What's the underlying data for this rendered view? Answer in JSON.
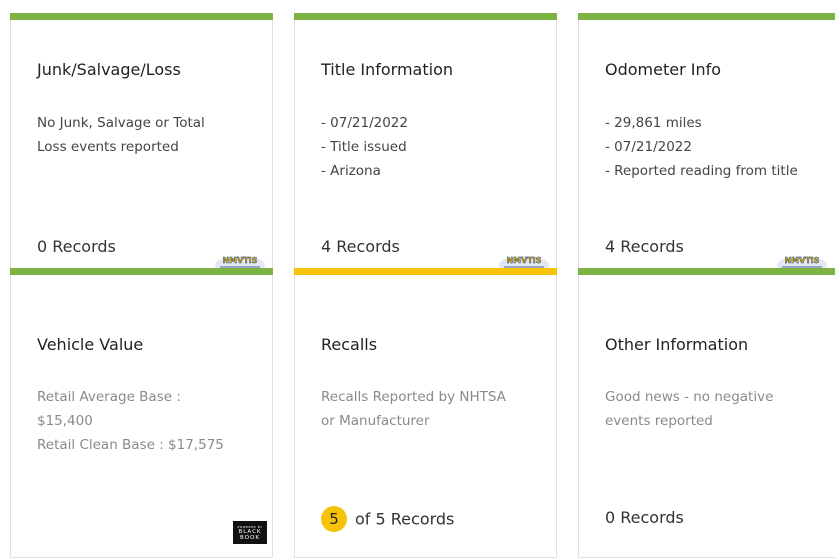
{
  "colors": {
    "green": "#7cb342",
    "yellow": "#f7c20a"
  },
  "cards": [
    {
      "title": "Junk/Salvage/Loss",
      "lines": [
        "No Junk, Salvage or Total",
        "Loss events reported"
      ],
      "records": "0 Records",
      "logo": "NMVTIS"
    },
    {
      "title": "Title Information",
      "lines": [
        "- 07/21/2022",
        "- Title issued",
        "- Arizona"
      ],
      "records": "4 Records",
      "logo": "NMVTIS"
    },
    {
      "title": "Odometer Info",
      "lines": [
        "- 29,861 miles",
        "- 07/21/2022",
        "- Reported reading from title"
      ],
      "records": "4 Records",
      "logo": "NMVTIS"
    },
    {
      "title": "Vehicle Value",
      "lines": [
        "Retail Average Base :",
        "$15,400",
        "Retail Clean Base : $17,575"
      ],
      "logo_top": "POWERED BY",
      "logo_line1": "BLACK",
      "logo_line2": "BOOK"
    },
    {
      "title": "Recalls",
      "lines": [
        "Recalls Reported by NHTSA",
        "or Manufacturer"
      ],
      "badge": "5",
      "records": "of  5 Records"
    },
    {
      "title": "Other Information",
      "lines": [
        "Good news - no negative",
        "events reported"
      ],
      "records": "0 Records"
    }
  ]
}
